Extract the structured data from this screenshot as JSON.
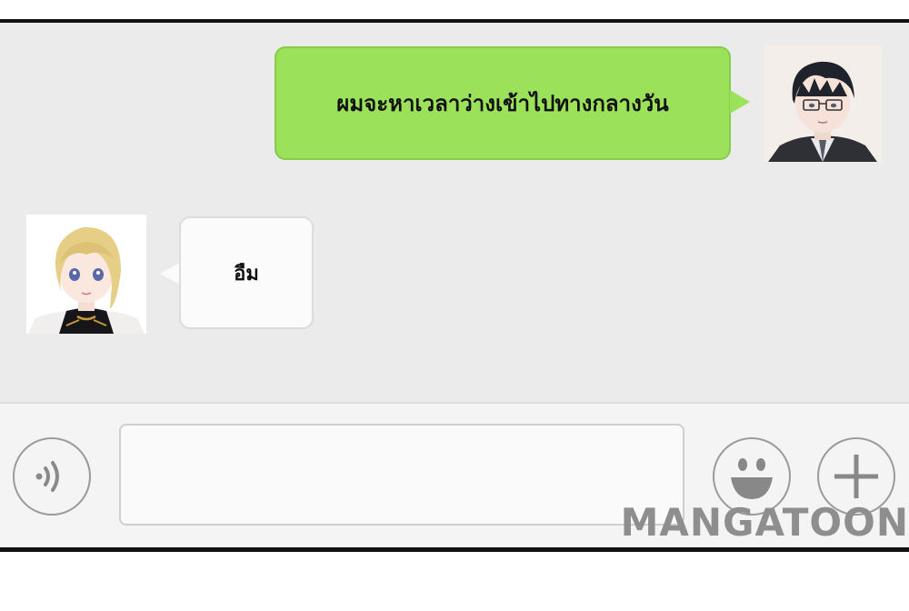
{
  "messages": [
    {
      "sender": "outgoing",
      "text": "ผมจะหาเวลาว่างเข้าไปทางกลางวัน",
      "color": "#9be25a"
    },
    {
      "sender": "incoming",
      "text": "อืม",
      "color": "#fbfbfb"
    }
  ],
  "input_bar": {
    "voice_icon": "voice-icon",
    "emoji_icon": "smiley-icon",
    "add_icon": "plus-icon"
  },
  "watermark": "MANGATOON"
}
